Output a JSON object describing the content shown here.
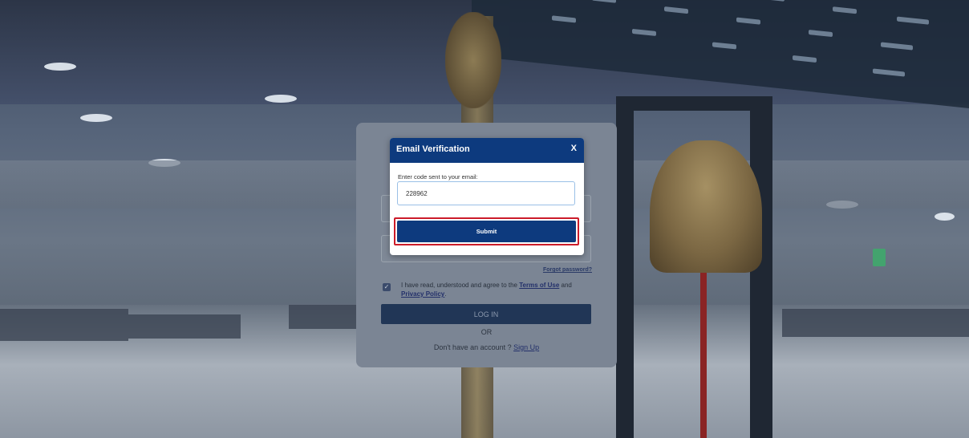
{
  "modal": {
    "title": "Email Verification",
    "close_label": "X",
    "code_label": "Enter code sent to your email:",
    "code_value": "228962",
    "submit_label": "Submit",
    "highlight_color": "#cc1c2a",
    "accent_color": "#0d3a7e"
  },
  "login": {
    "forgot_password": "Forgot password?",
    "agree_text_before": "I have read, understood and agree to the ",
    "terms_link": "Terms of Use",
    "agree_and": " and ",
    "privacy_link": "Privacy Policy",
    "agree_end": ".",
    "agree_checked": true,
    "login_button": "LOG IN",
    "or_text": "OR",
    "signup_prompt": "Don't have an account ? ",
    "signup_link": "Sign Up"
  },
  "icons": {
    "checkbox": "checkmark-icon"
  }
}
